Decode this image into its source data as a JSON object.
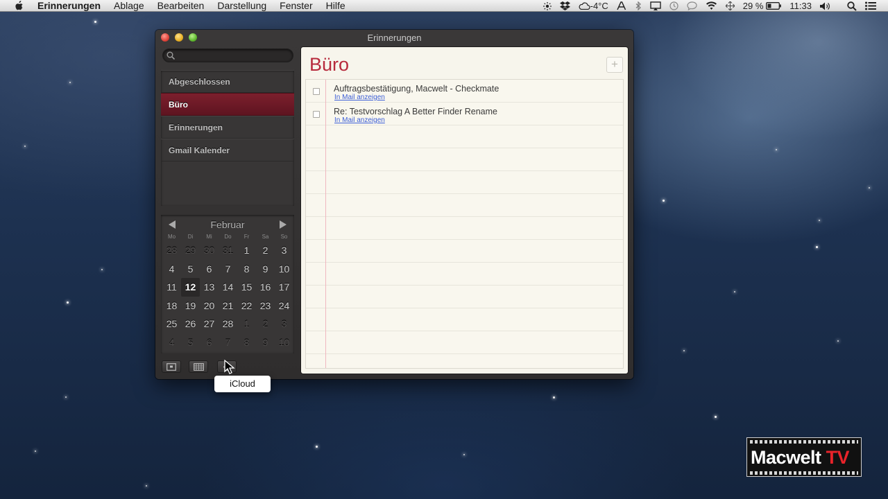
{
  "menubar": {
    "app_name": "Erinnerungen",
    "items": [
      "Ablage",
      "Bearbeiten",
      "Darstellung",
      "Fenster",
      "Hilfe"
    ],
    "status": {
      "weather": "-4°C",
      "battery": "29 %",
      "time": "11:33"
    }
  },
  "window": {
    "title": "Erinnerungen",
    "search": {
      "placeholder": ""
    },
    "lists": [
      {
        "label": "Abgeschlossen"
      },
      {
        "label": "Büro"
      },
      {
        "label": "Erinnerungen"
      },
      {
        "label": "Gmail Kalender"
      }
    ],
    "active_list": "Büro",
    "calendar": {
      "month": "Februar",
      "weekdays": [
        "Mo",
        "Di",
        "Mi",
        "Do",
        "Fr",
        "Sa",
        "So"
      ],
      "weeks": [
        [
          "28",
          "29",
          "30",
          "31",
          "1",
          "2",
          "3"
        ],
        [
          "4",
          "5",
          "6",
          "7",
          "8",
          "9",
          "10"
        ],
        [
          "11",
          "12",
          "13",
          "14",
          "15",
          "16",
          "17"
        ],
        [
          "18",
          "19",
          "20",
          "21",
          "22",
          "23",
          "24"
        ],
        [
          "25",
          "26",
          "27",
          "28",
          "1",
          "2",
          "3"
        ],
        [
          "4",
          "5",
          "6",
          "7",
          "8",
          "9",
          "10"
        ]
      ],
      "today": "12"
    },
    "pane": {
      "title": "Büro",
      "add_label": "+",
      "tasks": [
        {
          "title": "Auftragsbestätigung, Macwelt - Checkmate",
          "link": "In Mail anzeigen"
        },
        {
          "title": "Re: Testvorschlag A Better Finder Rename",
          "link": "In Mail anzeigen"
        }
      ]
    },
    "bottom_buttons": [
      "show-completed-icon",
      "calendar-icon",
      "add-icon"
    ]
  },
  "popup": {
    "label": "iCloud"
  },
  "watermark": {
    "brand": "Macwelt",
    "suffix": "TV"
  },
  "colors": {
    "accent_red": "#b72a3c",
    "selection": "#7c1f2d",
    "link": "#3d5fd6"
  }
}
